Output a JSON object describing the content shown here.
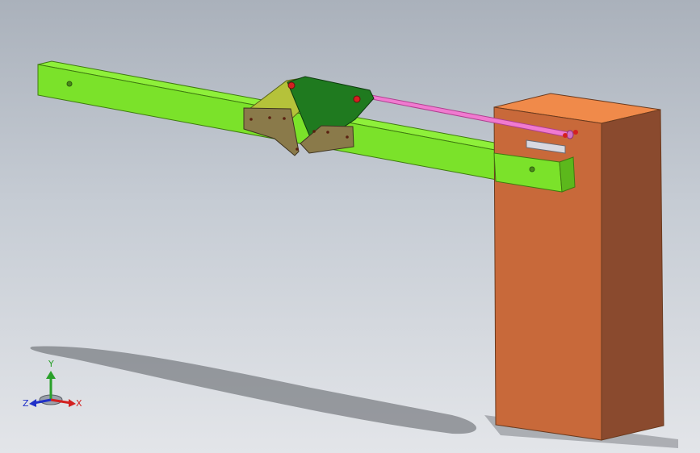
{
  "scene": {
    "colors": {
      "arm": "#7be22a",
      "arm_top": "#8ef03a",
      "arm_edge": "#3f7a10",
      "housing_front": "#c8693a",
      "housing_side": "#8a4a2e",
      "housing_top": "#f08a4a",
      "rod": "#f07ad0",
      "linkage_dark": "#1f7a1f",
      "linkage_yellow": "#b5c23a",
      "plates": "#8a7a4a",
      "pins": "#d42020"
    }
  },
  "triad": {
    "x_label": "X",
    "y_label": "Y",
    "z_label": "Z",
    "x_color": "#d22020",
    "y_color": "#2aa02a",
    "z_color": "#2030c8"
  }
}
